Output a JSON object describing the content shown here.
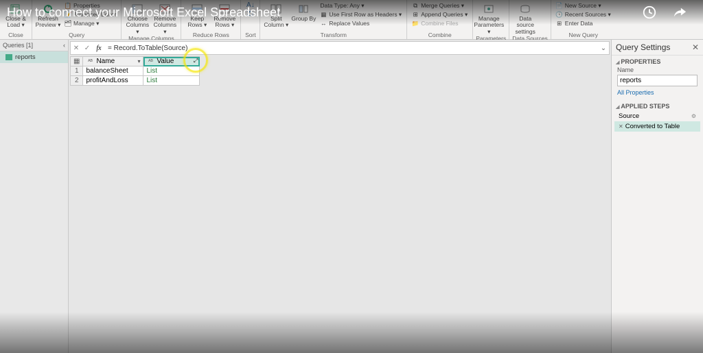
{
  "video": {
    "title": "How to connect your Microsoft Excel Spreadsheet"
  },
  "ribbon": {
    "close": {
      "close_load": "Close &\nLoad ▾",
      "group": "Close"
    },
    "query": {
      "refresh": "Refresh\nPreview ▾",
      "properties": "Properties",
      "advanced": "Advanced Editor",
      "manage": "Manage ▾",
      "group": "Query"
    },
    "manage_columns": {
      "choose": "Choose\nColumns ▾",
      "remove": "Remove\nColumns ▾",
      "group": "Manage Columns"
    },
    "reduce_rows": {
      "keep": "Keep\nRows ▾",
      "remove": "Remove\nRows ▾",
      "group": "Reduce Rows"
    },
    "sort": {
      "group": "Sort"
    },
    "transform": {
      "split": "Split\nColumn ▾",
      "groupby": "Group\nBy",
      "datatype": "Data Type: Any ▾",
      "firstrow": "Use First Row as Headers ▾",
      "replace": "Replace Values",
      "group": "Transform"
    },
    "combine": {
      "merge": "Merge Queries ▾",
      "append": "Append Queries ▾",
      "combinefiles": "Combine Files",
      "group": "Combine"
    },
    "parameters": {
      "manage": "Manage\nParameters ▾",
      "group": "Parameters"
    },
    "datasources": {
      "settings": "Data source\nsettings",
      "group": "Data Sources"
    },
    "newquery": {
      "newsource": "New Source ▾",
      "recent": "Recent Sources ▾",
      "enter": "Enter Data",
      "group": "New Query"
    }
  },
  "queries": {
    "header": "Queries [1]",
    "items": [
      {
        "name": "reports"
      }
    ]
  },
  "formula": {
    "text": "= Record.ToTable(Source)"
  },
  "grid": {
    "columns": [
      {
        "label": "Name"
      },
      {
        "label": "Value"
      }
    ],
    "rows": [
      {
        "n": "1",
        "name": "balanceSheet",
        "value": "List"
      },
      {
        "n": "2",
        "name": "profitAndLoss",
        "value": "List"
      }
    ]
  },
  "settings": {
    "title": "Query Settings",
    "properties_title": "PROPERTIES",
    "name_label": "Name",
    "name_value": "reports",
    "all_properties": "All Properties",
    "steps_title": "APPLIED STEPS",
    "steps": [
      {
        "label": "Source",
        "gear": true
      },
      {
        "label": "Converted to Table",
        "x": true
      }
    ]
  }
}
